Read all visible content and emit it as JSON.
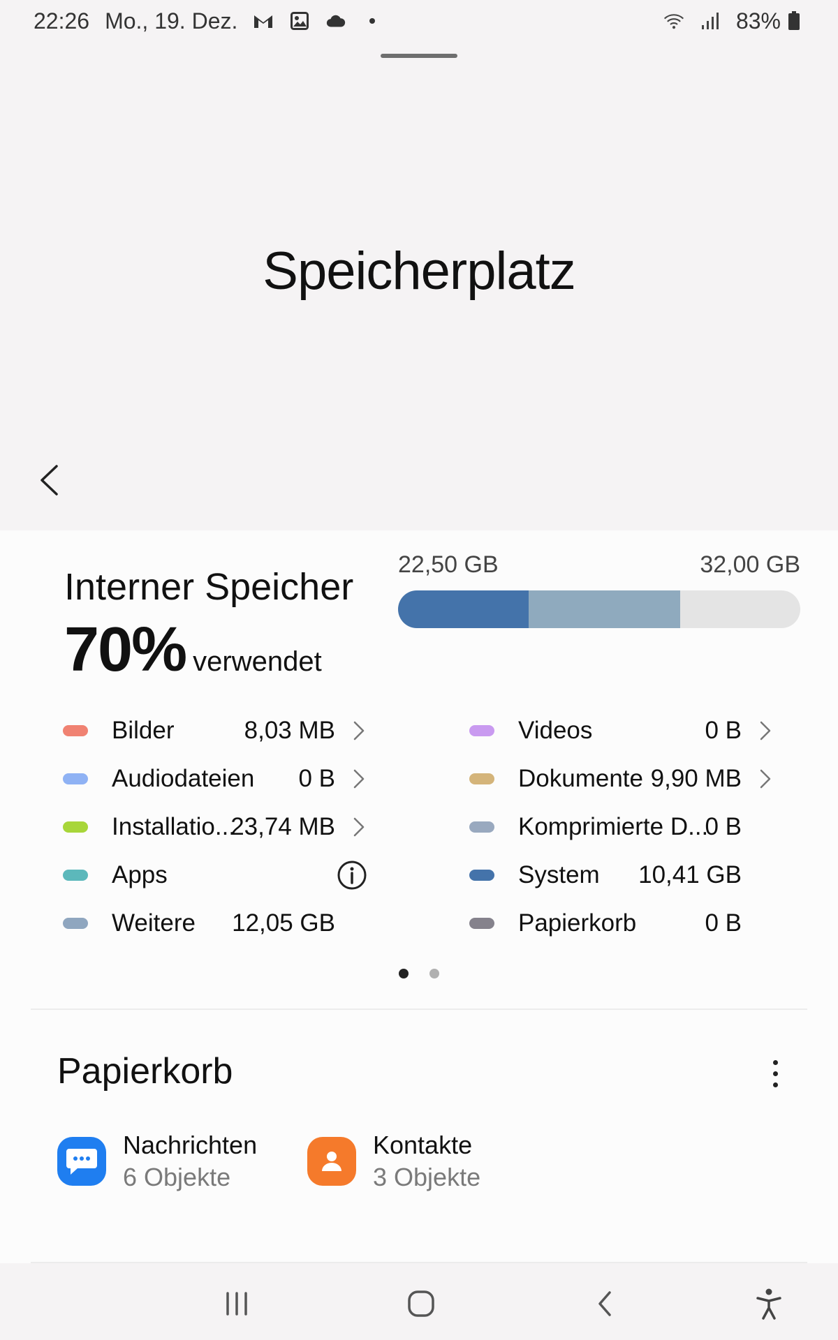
{
  "status_bar": {
    "time": "22:26",
    "date": "Mo., 19. Dez.",
    "notification_icons": [
      "gmail-icon",
      "gallery-icon",
      "cloud-icon",
      "dot-icon"
    ],
    "system_icons": [
      "wifi-icon",
      "signal-icon",
      "battery-icon"
    ],
    "battery": "83%"
  },
  "header": {
    "title": "Speicherplatz"
  },
  "storage": {
    "heading": "Interner Speicher",
    "percent": "70%",
    "used_word": "verwendet",
    "used_label": "22,50 GB",
    "total_label": "32,00 GB",
    "bar_segments": [
      {
        "name": "System",
        "fraction": 0.325,
        "color": "#4473aa"
      },
      {
        "name": "Weitere",
        "fraction": 0.377,
        "color": "#8faabe"
      }
    ],
    "bar_track_color": "#e4e4e4"
  },
  "categories_left": [
    {
      "label": "Bilder",
      "size": "8,03 MB",
      "color": "#f08272",
      "action": "chevron"
    },
    {
      "label": "Audiodateien",
      "size": "0 B",
      "color": "#8fb2f4",
      "action": "chevron"
    },
    {
      "label": "Installatio...",
      "size": "23,74 MB",
      "color": "#a8d63a",
      "action": "chevron"
    },
    {
      "label": "Apps",
      "size": "",
      "color": "#5cb8bb",
      "action": "info"
    },
    {
      "label": "Weitere",
      "size": "12,05 GB",
      "color": "#8fa6bf",
      "action": "none"
    }
  ],
  "categories_right": [
    {
      "label": "Videos",
      "size": "0 B",
      "color": "#c99af0",
      "action": "chevron"
    },
    {
      "label": "Dokumente",
      "size": "9,90 MB",
      "color": "#d4b47a",
      "action": "chevron"
    },
    {
      "label": "Komprimierte D...",
      "size": "0 B",
      "color": "#99a9bf",
      "action": "none"
    },
    {
      "label": "System",
      "size": "10,41 GB",
      "color": "#4473aa",
      "action": "none"
    },
    {
      "label": "Papierkorb",
      "size": "0 B",
      "color": "#85828c",
      "action": "none"
    }
  ],
  "pager": {
    "count": 2,
    "active": 0
  },
  "trash": {
    "heading": "Papierkorb",
    "items": [
      {
        "name": "Nachrichten",
        "count": "6 Objekte",
        "icon": "messages-icon",
        "color": "#1f7ef0"
      },
      {
        "name": "Kontakte",
        "count": "3 Objekte",
        "icon": "contacts-icon",
        "color": "#f57a2b"
      }
    ]
  },
  "nav_bar": {
    "buttons": [
      "recents-icon",
      "home-icon",
      "back-icon",
      "accessibility-icon"
    ]
  }
}
